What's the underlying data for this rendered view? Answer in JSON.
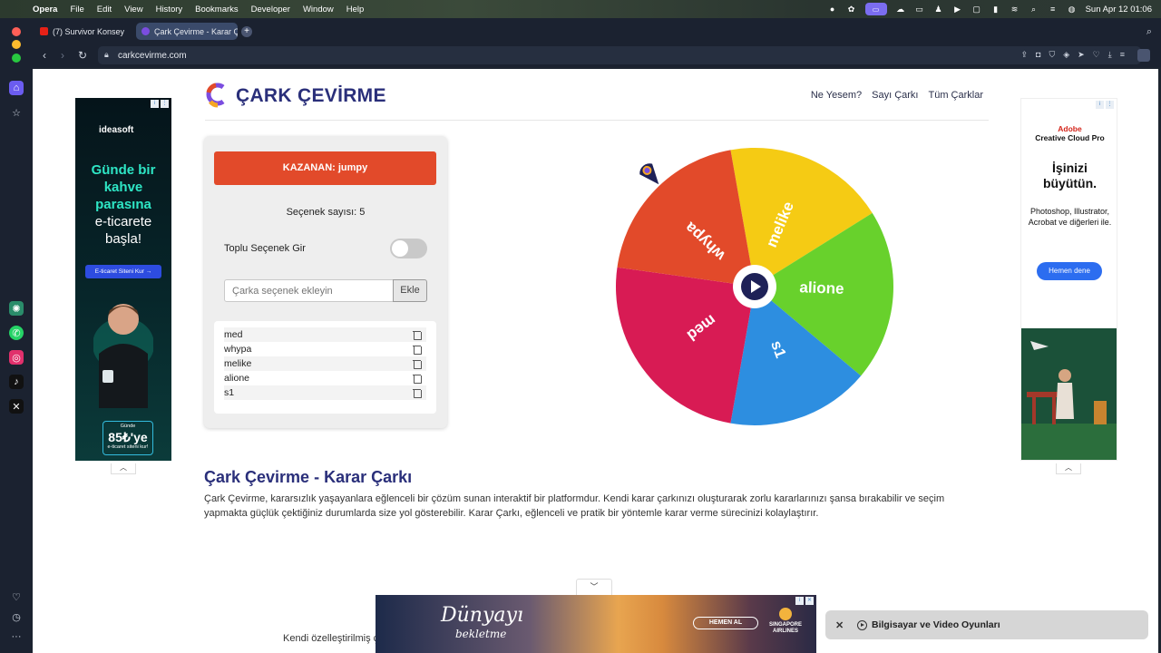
{
  "menubar": {
    "app": "Opera",
    "items": [
      "File",
      "Edit",
      "View",
      "History",
      "Bookmarks",
      "Developer",
      "Window",
      "Help"
    ],
    "clock": "Sun Apr 12  01:06"
  },
  "tabs": [
    {
      "label": "(7) Survivor Konsey",
      "favicon_color": "#e62117"
    },
    {
      "label": "Çark Çevirme - Karar Çarkı",
      "favicon_color": "#7b4de0"
    }
  ],
  "address": {
    "url": "carkcevirme.com"
  },
  "site": {
    "title": "ÇARK ÇEVİRME",
    "nav": [
      "Ne Yesem?",
      "Sayı Çarkı",
      "Tüm Çarklar"
    ]
  },
  "panel": {
    "winner": "KAZANAN: jumpy",
    "count_label": "Seçenek sayısı: 5",
    "bulk_label": "Toplu Seçenek Gir",
    "bulk_enabled": false,
    "input_placeholder": "Çarka seçenek ekleyin",
    "add_label": "Ekle",
    "options": [
      "med",
      "whypa",
      "melike",
      "alione",
      "s1"
    ]
  },
  "wheel": {
    "segments": [
      {
        "label": "melike",
        "color": "#f5cb14"
      },
      {
        "label": "alione",
        "color": "#68d12c"
      },
      {
        "label": "s1",
        "color": "#2d8ee0"
      },
      {
        "label": "med",
        "color": "#d81b54"
      },
      {
        "label": "whypa",
        "color": "#e24a2a"
      }
    ],
    "play_icon": "play-icon",
    "pointer_icon": "pointer-icon"
  },
  "article": {
    "title": "Çark Çevirme - Karar Çarkı",
    "body": "Çark Çevirme, kararsızlık yaşayanlara eğlenceli bir çözüm sunan interaktif bir platformdur. Kendi karar çarkınızı oluşturarak zorlu kararlarınızı şansa bırakabilir ve seçim yapmakta güçlük çektiğiniz durumlarda size yol gösterebilir. Karar Çarkı, eğlenceli ve pratik bir yöntemle karar verme sürecinizi kolaylaştırır.",
    "trailing": "Kendi özelleştirilmiş ç"
  },
  "ads": {
    "left": {
      "brand": "ideasoft",
      "line1": "Günde bir",
      "line2": "kahve",
      "line3": "parasına",
      "line4": "e-ticarete",
      "line5": "başla!",
      "cta": "E-ticaret Siteni Kur →",
      "offer_top": "Günde",
      "offer_price": "85₺'ye",
      "offer_bottom": "e-ticaret siteni kur!"
    },
    "right": {
      "brand_line1": "Adobe",
      "brand_line2": "Creative Cloud Pro",
      "headline1": "İşinizi",
      "headline2": "büyütün.",
      "apps": "Photoshop, Illustrator, Acrobat ve diğerleri ile.",
      "cta": "Hemen dene"
    },
    "bottom": {
      "title": "Dünyayı",
      "subtitle": "bekletme",
      "cta": "HEMEN AL",
      "airline1": "SINGAPORE",
      "airline2": "AIRLINES"
    }
  },
  "toast": {
    "label": "Bilgisayar ve Video Oyunları"
  }
}
